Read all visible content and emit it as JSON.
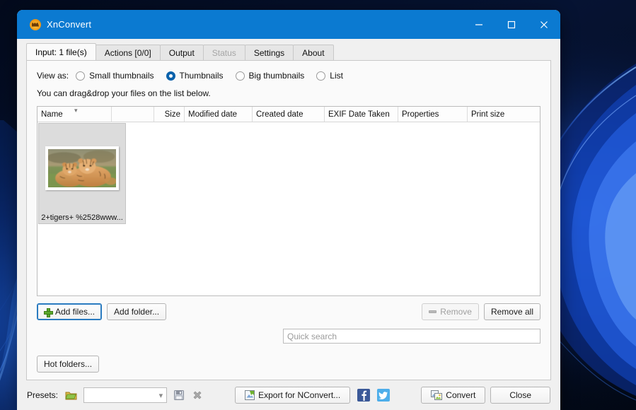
{
  "window": {
    "title": "XnConvert",
    "app_icon": "xnconvert-logo-icon",
    "controls": {
      "minimize": "minimize-icon",
      "maximize": "maximize-icon",
      "close": "close-icon"
    }
  },
  "tabs": [
    {
      "label": "Input: 1 file(s)",
      "state": "active"
    },
    {
      "label": "Actions [0/0]",
      "state": "normal"
    },
    {
      "label": "Output",
      "state": "normal"
    },
    {
      "label": "Status",
      "state": "disabled"
    },
    {
      "label": "Settings",
      "state": "normal"
    },
    {
      "label": "About",
      "state": "normal"
    }
  ],
  "input_tab": {
    "view_as_label": "View as:",
    "view_options": [
      {
        "label": "Small thumbnails",
        "checked": false
      },
      {
        "label": "Thumbnails",
        "checked": true
      },
      {
        "label": "Big thumbnails",
        "checked": false
      },
      {
        "label": "List",
        "checked": false
      }
    ],
    "hint": "You can drag&drop your files on the list below.",
    "columns": [
      {
        "label": "Name",
        "width": 105,
        "align": "left",
        "sorted": true
      },
      {
        "label": "",
        "width": 60,
        "align": "left",
        "sorted": false
      },
      {
        "label": "Size",
        "width": 43,
        "align": "right",
        "sorted": false
      },
      {
        "label": "Modified date",
        "width": 96,
        "align": "left",
        "sorted": false
      },
      {
        "label": "Created date",
        "width": 102,
        "align": "left",
        "sorted": false
      },
      {
        "label": "EXIF Date Taken",
        "width": 104,
        "align": "left",
        "sorted": false
      },
      {
        "label": "Properties",
        "width": 98,
        "align": "left",
        "sorted": false
      },
      {
        "label": "Print size",
        "width": 88,
        "align": "left",
        "sorted": false
      }
    ],
    "files": [
      {
        "name": "2+tigers+ %2528www...",
        "size": "",
        "modified_date": "",
        "created_date": "",
        "exif_date_taken": "",
        "properties": "",
        "print_size": "",
        "thumbnail_alt": "two tiger cubs lying in grass"
      }
    ],
    "buttons": {
      "add_files": "Add files...",
      "add_folder": "Add folder...",
      "remove": "Remove",
      "remove_all": "Remove all",
      "hot_folders": "Hot folders..."
    },
    "search": {
      "placeholder": "Quick search",
      "value": ""
    }
  },
  "bottom_bar": {
    "presets_label": "Presets:",
    "presets_value": "",
    "open_preset_icon": "open-folder-icon",
    "save_preset_icon": "save-disk-icon",
    "delete_preset_icon": "delete-x-icon",
    "export_button": "Export for NConvert...",
    "facebook_icon": "facebook-icon",
    "twitter_icon": "twitter-icon",
    "convert_button": "Convert",
    "close_button": "Close"
  },
  "colors": {
    "titlebar": "#0b7ad1",
    "accent_radio": "#0b63ad",
    "focus_outline": "#2a7bc0",
    "window_bg": "#f0f0f0",
    "page_bg": "#fafafa",
    "disabled_text": "#a6a6a6"
  }
}
